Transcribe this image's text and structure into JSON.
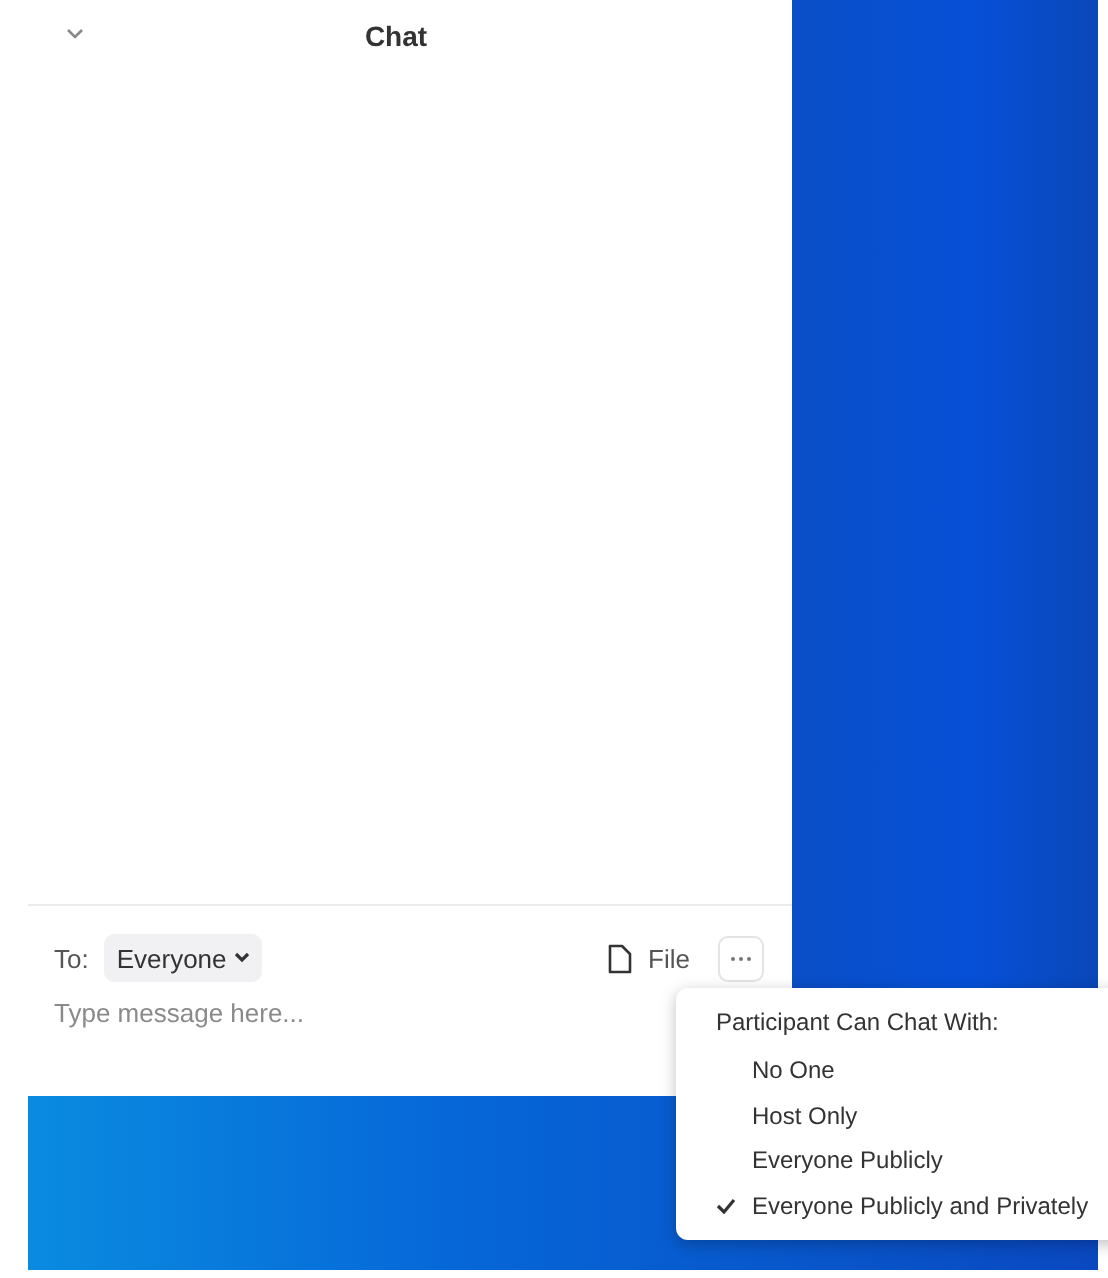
{
  "chat_panel": {
    "title": "Chat"
  },
  "composer": {
    "to_label": "To:",
    "recipient": "Everyone",
    "file_label": "File",
    "placeholder": "Type message here..."
  },
  "menu": {
    "title": "Participant Can Chat With:",
    "options": [
      {
        "label": "No One",
        "selected": false
      },
      {
        "label": "Host Only",
        "selected": false
      },
      {
        "label": "Everyone Publicly",
        "selected": false
      },
      {
        "label": "Everyone Publicly and Privately",
        "selected": true
      }
    ]
  }
}
